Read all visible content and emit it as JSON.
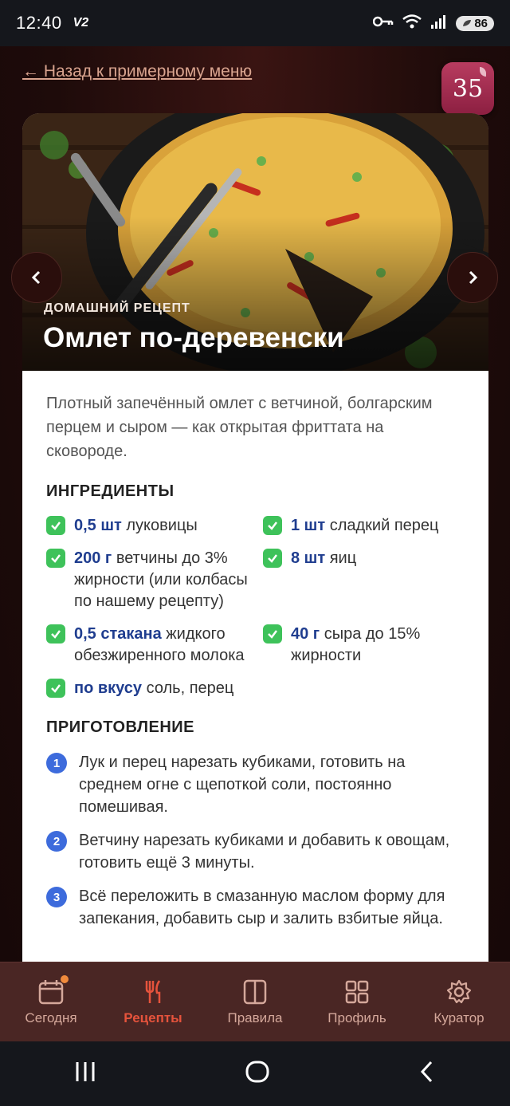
{
  "status_bar": {
    "time": "12:40",
    "network_tag": "V2",
    "battery": "86"
  },
  "header": {
    "back_link": "← Назад к примерному меню",
    "day_badge": "35"
  },
  "recipe": {
    "tag": "ДОМАШНИЙ РЕЦЕПТ",
    "title": "Омлет по-деревенски",
    "description": "Плотный запечённый омлет с ветчиной, болгарским перцем и сыром — как открытая фриттата на сковороде.",
    "ingredients_title": "ИНГРЕДИЕНТЫ",
    "ingredients": [
      {
        "qty": "0,5 шт",
        "text": " луковицы"
      },
      {
        "qty": "1 шт",
        "text": " сладкий перец"
      },
      {
        "qty": "200 г",
        "text": " ветчины до 3% жирности (или колбасы по нашему рецепту)"
      },
      {
        "qty": "8 шт",
        "text": " яиц"
      },
      {
        "qty": "0,5 стакана",
        "text": " жидкого обезжиренного молока"
      },
      {
        "qty": "40 г",
        "text": " сыра до 15% жирности"
      },
      {
        "qty": "по вкусу",
        "text": " соль, перец"
      }
    ],
    "preparation_title": "ПРИГОТОВЛЕНИЕ",
    "steps": [
      {
        "num": "1",
        "text": "Лук и перец нарезать кубиками, готовить на среднем огне с щепоткой соли, постоянно помешивая."
      },
      {
        "num": "2",
        "text": "Ветчину нарезать кубиками и добавить к овощам, готовить ещё 3 минуты."
      },
      {
        "num": "3",
        "text": "Всё переложить в смазанную маслом форму для запекания, добавить сыр и залить взбитые яйца."
      }
    ]
  },
  "tabs": [
    {
      "label": "Сегодня",
      "icon": "calendar-icon"
    },
    {
      "label": "Рецепты",
      "icon": "fork-knife-icon"
    },
    {
      "label": "Правила",
      "icon": "book-icon"
    },
    {
      "label": "Профиль",
      "icon": "grid-icon"
    },
    {
      "label": "Куратор",
      "icon": "gear-icon"
    }
  ],
  "colors": {
    "accent": "#e6533c",
    "quantity": "#1f3d8f",
    "check": "#3ec25a",
    "step_badge": "#3d6bdc"
  }
}
